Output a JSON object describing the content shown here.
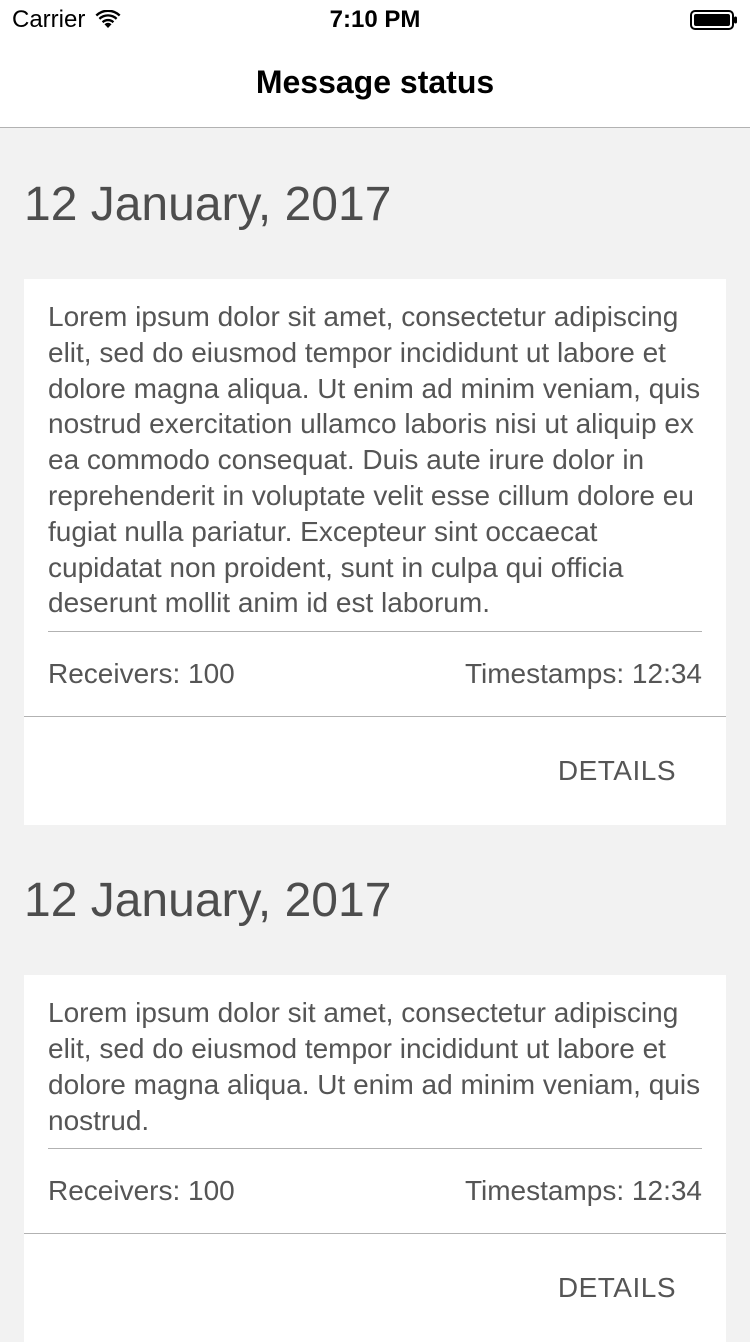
{
  "status_bar": {
    "carrier": "Carrier",
    "time": "7:10 PM",
    "battery_icon": "battery-full-icon",
    "wifi_icon": "wifi-icon"
  },
  "nav": {
    "title": "Message status"
  },
  "sections": [
    {
      "date": "12 January, 2017",
      "message": "Lorem ipsum dolor sit amet, consectetur adipiscing elit, sed do eiusmod tempor incididunt ut labore et dolore magna aliqua. Ut enim ad minim veniam, quis nostrud exercitation ullamco laboris nisi ut aliquip ex ea commodo consequat. Duis aute irure dolor in reprehenderit in voluptate velit esse cillum dolore eu fugiat nulla pariatur. Excepteur sint occaecat cupidatat non proident, sunt in culpa qui officia deserunt mollit anim id est laborum.",
      "receivers": "Receivers: 100",
      "timestamps": "Timestamps: 12:34",
      "details_label": "DETAILS"
    },
    {
      "date": "12 January, 2017",
      "message": "Lorem ipsum dolor sit amet, consectetur adipiscing elit, sed do eiusmod tempor incididunt ut labore et dolore magna aliqua. Ut enim ad minim veniam, quis nostrud.",
      "receivers": "Receivers: 100",
      "timestamps": "Timestamps: 12:34",
      "details_label": "DETAILS"
    }
  ],
  "colors": {
    "background": "#f2f2f2",
    "card": "#ffffff",
    "text": "#555555",
    "divider": "#b2b2b2"
  }
}
